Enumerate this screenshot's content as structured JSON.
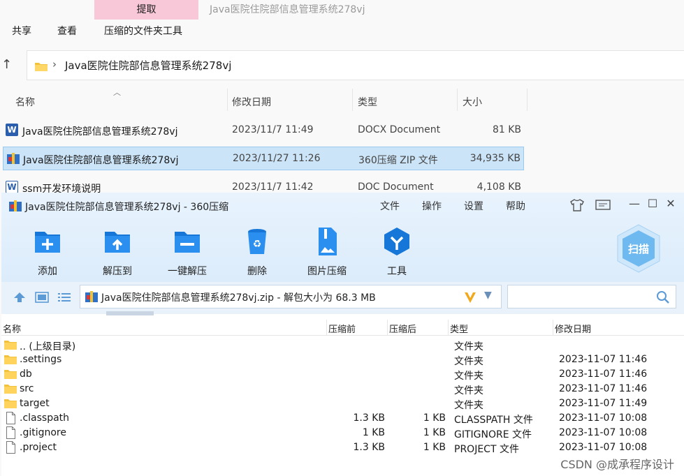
{
  "explorer": {
    "extract_tab": "提取",
    "title": "Java医院住院部信息管理系统278vj",
    "ribbon_tabs": [
      "共享",
      "查看",
      "压缩的文件夹工具"
    ],
    "address": "Java医院住院部信息管理系统278vj",
    "columns": [
      "名称",
      "修改日期",
      "类型",
      "大小"
    ],
    "files": [
      {
        "name": "Java医院住院部信息管理系统278vj",
        "date": "2023/11/7 11:49",
        "type": "DOCX Document",
        "size": "81 KB",
        "icon": "word-docx-icon"
      },
      {
        "name": "Java医院住院部信息管理系统278vj",
        "date": "2023/11/27 11:26",
        "type": "360压缩 ZIP 文件",
        "size": "34,935 KB",
        "icon": "zip-archive-icon"
      },
      {
        "name": "ssm开发环境说明",
        "date": "2023/11/7 11:42",
        "type": "DOC Document",
        "size": "4,108 KB",
        "icon": "word-doc-icon"
      }
    ]
  },
  "zipwin": {
    "title": "Java医院住院部信息管理系统278vj - 360压缩",
    "menu": [
      "文件",
      "操作",
      "设置",
      "帮助"
    ],
    "tools": [
      "添加",
      "解压到",
      "一键解压",
      "删除",
      "图片压缩",
      "工具"
    ],
    "scan_label": "扫描",
    "path": "Java医院住院部信息管理系统278vj.zip - 解包大小为 68.3 MB",
    "columns": [
      "名称",
      "压缩前",
      "压缩后",
      "类型",
      "修改日期"
    ],
    "rows": [
      {
        "name": ".. (上级目录)",
        "before": "",
        "after": "",
        "type": "文件夹",
        "date": "",
        "icon": "folder"
      },
      {
        "name": ".settings",
        "before": "",
        "after": "",
        "type": "文件夹",
        "date": "2023-11-07 11:46",
        "icon": "folder"
      },
      {
        "name": "db",
        "before": "",
        "after": "",
        "type": "文件夹",
        "date": "2023-11-07 11:46",
        "icon": "folder"
      },
      {
        "name": "src",
        "before": "",
        "after": "",
        "type": "文件夹",
        "date": "2023-11-07 11:46",
        "icon": "folder"
      },
      {
        "name": "target",
        "before": "",
        "after": "",
        "type": "文件夹",
        "date": "2023-11-07 11:49",
        "icon": "folder"
      },
      {
        "name": ".classpath",
        "before": "1.3 KB",
        "after": "1 KB",
        "type": "CLASSPATH 文件",
        "date": "2023-11-07 10:08",
        "icon": "file"
      },
      {
        "name": ".gitignore",
        "before": "1 KB",
        "after": "1 KB",
        "type": "GITIGNORE 文件",
        "date": "2023-11-07 10:08",
        "icon": "file"
      },
      {
        "name": ".project",
        "before": "1.3 KB",
        "after": "1 KB",
        "type": "PROJECT 文件",
        "date": "2023-11-07 10:08",
        "icon": "file"
      }
    ]
  },
  "watermark": "CSDN @成承程序设计"
}
